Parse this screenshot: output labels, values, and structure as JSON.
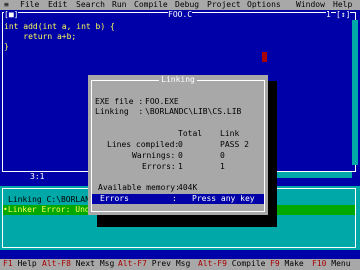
{
  "menubar": {
    "system": "≡",
    "items": [
      {
        "label": "File"
      },
      {
        "label": "Edit"
      },
      {
        "label": "Search"
      },
      {
        "label": "Run"
      },
      {
        "label": "Compile"
      },
      {
        "label": "Debug"
      },
      {
        "label": "Project"
      },
      {
        "label": "Options"
      },
      {
        "label": "Window"
      },
      {
        "label": "Help"
      }
    ]
  },
  "editor": {
    "close": "[■]",
    "title": "FOO.C",
    "window_number": "1",
    "zoom": "[↕]",
    "lines": [
      "int add(int a, int b) {",
      "    return a+b;",
      "}"
    ],
    "position": "3:1"
  },
  "message_window": {
    "line1": "Linking C:\\BORLAND",
    "line2": "•Linker Error: Und"
  },
  "dialog": {
    "title": "Linking",
    "exe_label": "EXE file :",
    "exe_value": "FOO.EXE",
    "linking_label": "Linking  :",
    "linking_value": "\\BORLANDC\\LIB\\CS.LIB",
    "col_total": "Total",
    "col_link": "Link",
    "rows": [
      {
        "label": "Lines compiled:",
        "total": "0",
        "link": "PASS 2"
      },
      {
        "label": "Warnings:",
        "total": "0",
        "link": "0"
      },
      {
        "label": "Errors:",
        "total": "1",
        "link": "1"
      }
    ],
    "memory_label": "Available memory:",
    "memory_value": "404K",
    "status_left": "Errors",
    "status_sep": ":",
    "status_right": "Press any key"
  },
  "statusbar": {
    "items": [
      {
        "key": "F1",
        "label": "Help"
      },
      {
        "key": "Alt-F8",
        "label": "Next Msg"
      },
      {
        "key": "Alt-F7",
        "label": "Prev Msg"
      },
      {
        "key": "Alt-F9",
        "label": "Compile"
      },
      {
        "key": "F9",
        "label": "Make"
      },
      {
        "key": "F10",
        "label": "Menu"
      }
    ]
  }
}
